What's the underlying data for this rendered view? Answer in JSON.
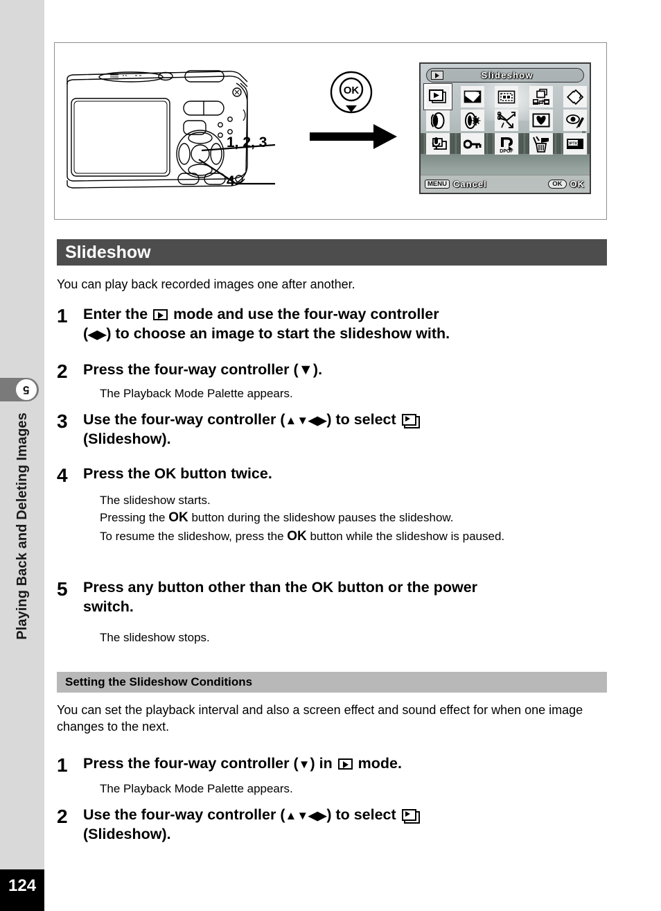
{
  "sidebar": {
    "chapter_number": "5",
    "chapter_title": "Playing Back and Deleting Images",
    "page_number": "124"
  },
  "illustration": {
    "callout_top": "1, 2, 3",
    "callout_bottom": "4",
    "ok_button_label": "OK",
    "lcd": {
      "title": "Slideshow",
      "mode_icon": "playback-mode-icon",
      "menu_tag": "MENU",
      "cancel_label": "Cancel",
      "ok_tag": "OK",
      "ok_label": "OK",
      "palette_rows": [
        [
          "slideshow-icon",
          "image-rotation-icon",
          "frame-composite-icon",
          "image-copy-icon",
          "color-filter-icon"
        ],
        [
          "digital-filter-icon",
          "brightness-filter-icon",
          "trim-icon",
          "soft-filter-icon",
          "red-eye-icon"
        ],
        [
          "voice-memo-icon",
          "protect-key-icon",
          "dpof-icon",
          "delete-trash-icon",
          "start-screen-icon"
        ]
      ],
      "selected_icon": "slideshow-icon"
    }
  },
  "main": {
    "section_title": "Slideshow",
    "section_intro": "You can play back recorded images one after another.",
    "steps": [
      {
        "num": "1",
        "title_parts": [
          "Enter the ",
          "GLYPH_PLAY",
          " mode and use the four-way controller (",
          "GLYPH_LR",
          ") to choose an image to start the slideshow with."
        ],
        "title_text": "Enter the [playback] mode and use the four-way controller (◀▶) to choose an image to start the slideshow with.",
        "notes": []
      },
      {
        "num": "2",
        "title_text": "Press the four-way controller (▼).",
        "notes": [
          "The Playback Mode Palette appears."
        ]
      },
      {
        "num": "3",
        "title_text": "Use the four-way controller (▲▼◀▶) to select [slideshow] (Slideshow).",
        "notes": []
      },
      {
        "num": "4",
        "title_text": "Press the OK button twice.",
        "notes": [
          "The slideshow starts.",
          "Pressing the OK button during the slideshow pauses the slideshow.",
          "To resume the slideshow, press the OK button while the slideshow is paused."
        ]
      },
      {
        "num": "5",
        "title_text": "Press any button other than the OK button or the power switch.",
        "notes": [
          "The slideshow stops."
        ]
      }
    ],
    "subsection_title": "Setting the Slideshow Conditions",
    "subsection_intro": "You can set the playback interval and also a screen effect and sound effect for when one image changes to the next.",
    "sub_steps": [
      {
        "num": "1",
        "title_text": "Press the four-way controller (▼) in [playback] mode.",
        "notes": [
          "The Playback Mode Palette appears."
        ]
      },
      {
        "num": "2",
        "title_text": "Use the four-way controller (▲▼◀▶) to select [slideshow] (Slideshow).",
        "notes": []
      }
    ],
    "labels": {
      "ok_word": "OK",
      "slideshow_paren": "(Slideshow).",
      "four_way_controller": "four-way controller",
      "mode_word": "mode."
    }
  },
  "colors": {
    "section_header_bg": "#4d4d4d",
    "subsection_header_bg": "#b8b8b8",
    "sidebar_bg": "#d9d9d9",
    "chapter_tab_bg": "#7a7a7a",
    "page_number_bg": "#000000",
    "text": "#000000"
  }
}
